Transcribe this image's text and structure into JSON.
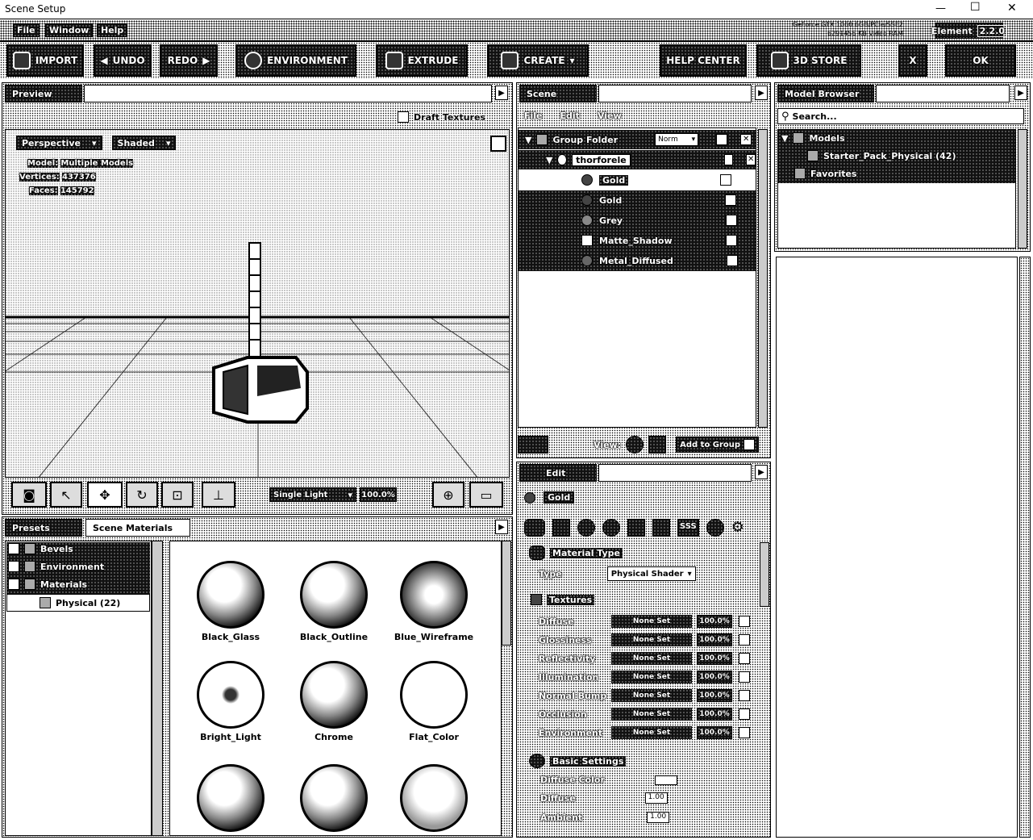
{
  "window": {
    "title": "Scene Setup",
    "minimize_glyph": "—",
    "maximize_glyph": "☐",
    "close_glyph": "✕"
  },
  "menu": {
    "items": [
      "File",
      "Window",
      "Help"
    ]
  },
  "gpu": {
    "line1": "GeForce GTX 1060 6GB/PCIe/SSE2",
    "line2": "6291456 KB Video RAM"
  },
  "element_badge": {
    "label": "Element",
    "version": "2.2.0"
  },
  "toolbar": {
    "import": "IMPORT",
    "undo": "UNDO",
    "redo": "REDO",
    "environment": "ENVIRONMENT",
    "extrude": "EXTRUDE",
    "create": "CREATE",
    "help_center": "HELP CENTER",
    "store": "3D STORE",
    "close": "X",
    "ok": "OK"
  },
  "preview": {
    "tab": "Preview",
    "draft_textures": "Draft Textures",
    "view_mode": "Perspective",
    "shading": "Shaded",
    "stats": {
      "model_label": "Model:",
      "model_value": "Multiple Models",
      "vertices_label": "Vertices:",
      "vertices_value": "437376",
      "faces_label": "Faces:",
      "faces_value": "145792"
    },
    "light_mode": "Single Light",
    "light_pct": "100.0%"
  },
  "bottom_left": {
    "tabs": [
      "Presets",
      "Scene Materials"
    ],
    "tree": [
      "Bevels",
      "Environment",
      "Materials"
    ],
    "subfolder": "Physical (22)"
  },
  "materials": [
    {
      "name": "Black_Glass"
    },
    {
      "name": "Black_Outline"
    },
    {
      "name": "Blue_Wireframe"
    },
    {
      "name": "Bright_Light"
    },
    {
      "name": "Chrome"
    },
    {
      "name": "Flat_Color"
    },
    {
      "name": ""
    },
    {
      "name": ""
    },
    {
      "name": ""
    }
  ],
  "scene": {
    "tab": "Scene",
    "menu": [
      "File",
      "Edit",
      "View"
    ],
    "group_folder": "Group Folder",
    "group_mode": "Norm",
    "object": "thorforele",
    "materials": [
      "Gold",
      "Gold",
      "Grey",
      "Matte_Shadow",
      "Metal_Diffused"
    ],
    "footer": {
      "view": "View:",
      "add_to_group": "Add to Group"
    }
  },
  "edit": {
    "tab": "Edit",
    "selected": "Gold",
    "tab_icons": [
      "mat-icon",
      "texture-icon",
      "sphere-icon",
      "clock-icon",
      "cup-icon",
      "light-icon",
      "sss-icon",
      "globe-icon",
      "gear-icon"
    ],
    "sss_label": "SSS",
    "material_type": {
      "header": "Material Type",
      "type_label": "Type",
      "type_value": "Physical Shader"
    },
    "textures": {
      "header": "Textures",
      "rows": [
        {
          "name": "Diffuse",
          "value": "None Set",
          "pct": "100.0%"
        },
        {
          "name": "Glossiness",
          "value": "None Set",
          "pct": "100.0%"
        },
        {
          "name": "Reflectivity",
          "value": "None Set",
          "pct": "100.0%"
        },
        {
          "name": "Illumination",
          "value": "None Set",
          "pct": "100.0%"
        },
        {
          "name": "Normal Bump",
          "value": "None Set",
          "pct": "100.0%"
        },
        {
          "name": "Occlusion",
          "value": "None Set",
          "pct": "100.0%"
        },
        {
          "name": "Environment",
          "value": "None Set",
          "pct": "100.0%"
        }
      ]
    },
    "basic": {
      "header": "Basic Settings",
      "diffuse_color": "Diffuse Color",
      "diffuse": "Diffuse",
      "diffuse_val": "1.00",
      "ambient": "Ambient",
      "ambient_val": "1.00"
    }
  },
  "model_browser": {
    "tab": "Model Browser",
    "search_placeholder": "Search...",
    "tree": {
      "models": "Models",
      "pack": "Starter_Pack_Physical (42)",
      "favorites": "Favorites"
    }
  }
}
